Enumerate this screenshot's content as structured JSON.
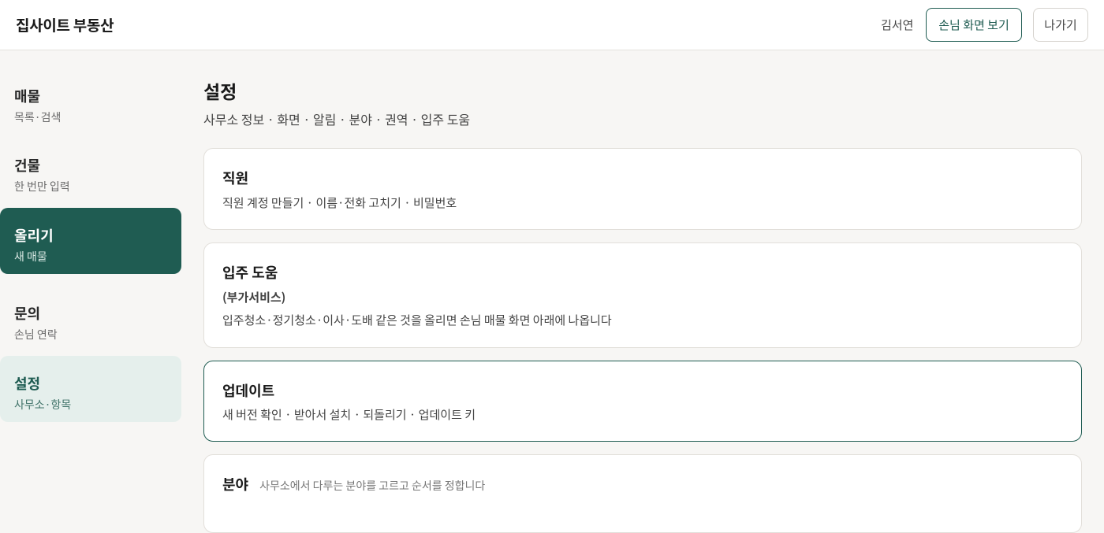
{
  "header": {
    "brand": "집사이트 부동산",
    "user_name": "김서연",
    "view_customer_label": "손님 화면 보기",
    "exit_label": "나가기"
  },
  "sidebar": {
    "items": [
      {
        "title": "매물",
        "sub": "목록·검색"
      },
      {
        "title": "건물",
        "sub": "한 번만 입력"
      },
      {
        "title": "올리기",
        "sub": "새 매물"
      },
      {
        "title": "문의",
        "sub": "손님 연락"
      },
      {
        "title": "설정",
        "sub": "사무소·항목"
      }
    ]
  },
  "main": {
    "title": "설정",
    "subtitle": "사무소 정보 · 화면 · 알림 · 분야 · 권역 · 입주 도움",
    "cards": [
      {
        "title": "직원",
        "desc": "직원 계정 만들기 · 이름·전화 고치기 · 비밀번호"
      },
      {
        "title": "입주 도움",
        "tag": "(부가서비스)",
        "desc": "입주청소·정기청소·이사·도배 같은 것을 올리면 손님 매물 화면 아래에 나옵니다"
      },
      {
        "title": "업데이트",
        "desc": "새 버전 확인 · 받아서 설치 · 되돌리기 · 업데이트 키"
      },
      {
        "title": "분야",
        "desc": "사무소에서 다루는 분야를 고르고 순서를 정합니다"
      }
    ]
  },
  "colors": {
    "accent": "#1f5c52",
    "accent_light": "#e5efec",
    "background": "#f7f6f4"
  }
}
